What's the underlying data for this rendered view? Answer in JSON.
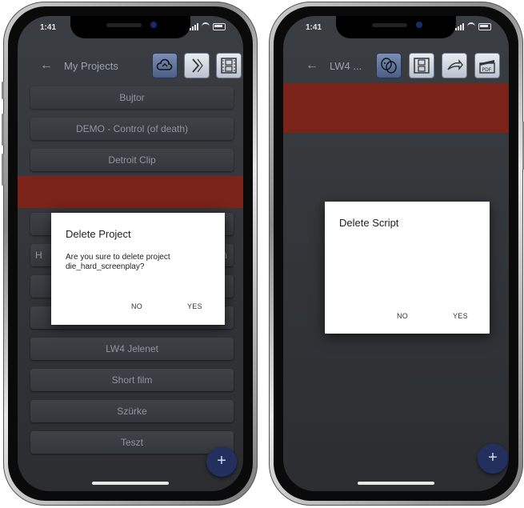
{
  "left_phone": {
    "status": {
      "time": "1:41"
    },
    "appbar": {
      "back_icon": "arrow-left-icon",
      "title": "My Projects",
      "tools": [
        "cloud-sync-icon",
        "export-icon",
        "film-strip-icon"
      ]
    },
    "projects": [
      "Bujtor",
      "DEMO - Control (of death)",
      "Detroit Clip",
      "",
      "",
      "H",
      "",
      "",
      "LW4 Jelenet",
      "Short film",
      "Szürke",
      "Teszt"
    ],
    "row_partial_right": "m",
    "selected_color": "#7a2318",
    "dialog": {
      "title": "Delete Project",
      "message": "Are you sure to delete project die_hard_screenplay?",
      "no_label": "NO",
      "yes_label": "YES"
    },
    "fab_label": "+"
  },
  "right_phone": {
    "status": {
      "time": "1:41"
    },
    "appbar": {
      "back_icon": "arrow-left-icon",
      "title": "LW4 ...",
      "tools": [
        "masks-icon",
        "film-frame-icon",
        "share-icon",
        "pdf-clapper-icon"
      ]
    },
    "selected_color": "#7a2318",
    "dialog": {
      "title": "Delete Script",
      "no_label": "NO",
      "yes_label": "YES"
    },
    "fab_label": "+"
  },
  "colors": {
    "screen_bg": "#2f3236",
    "fab": "#23305e",
    "tool_blue": "#5a6d95",
    "text_muted": "#8f96a0"
  }
}
